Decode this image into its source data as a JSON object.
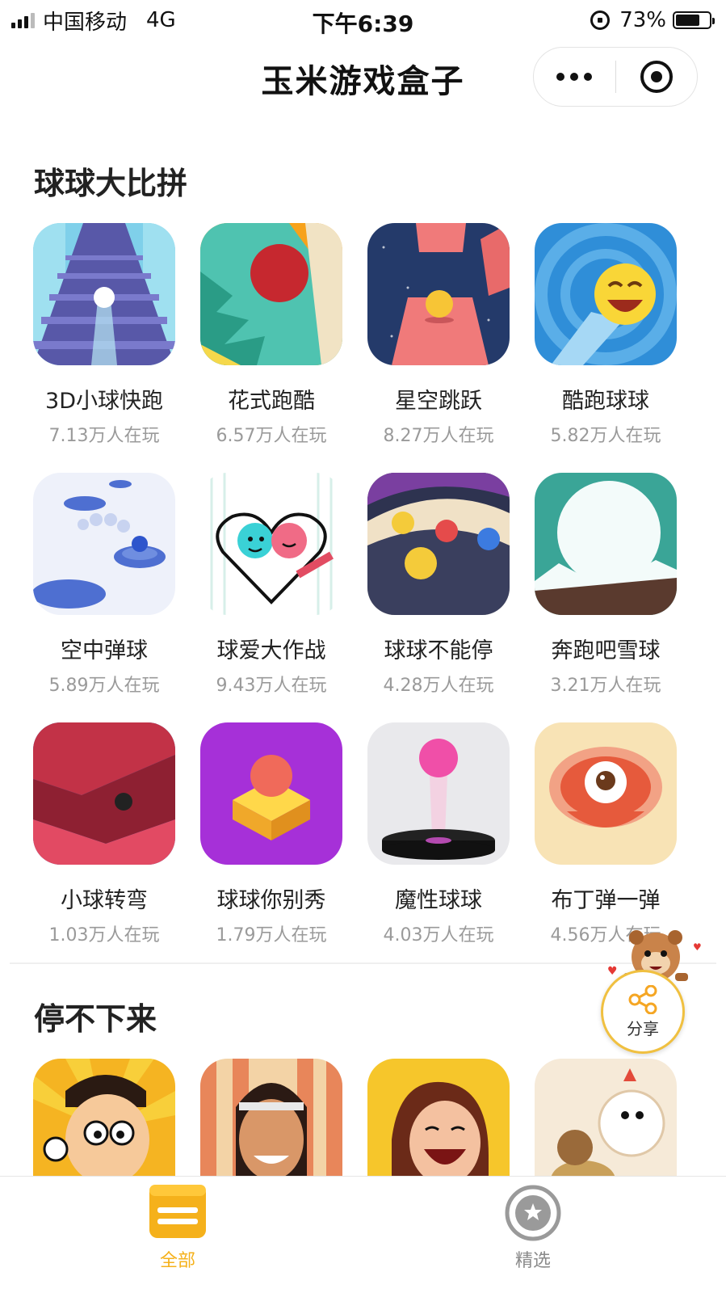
{
  "status_bar": {
    "carrier": "中国移动",
    "network": "4G",
    "time": "下午6:39",
    "battery": "73%",
    "battery_level": 0.73
  },
  "nav": {
    "title": "玉米游戏盒子",
    "more_icon": "more-dots-icon",
    "close_icon": "target-close-icon"
  },
  "sections": [
    {
      "title": "球球大比拼",
      "games": [
        {
          "name": "3D小球快跑",
          "players": "7.13万人在玩"
        },
        {
          "name": "花式跑酷",
          "players": "6.57万人在玩"
        },
        {
          "name": "星空跳跃",
          "players": "8.27万人在玩"
        },
        {
          "name": "酷跑球球",
          "players": "5.82万人在玩"
        },
        {
          "name": "空中弹球",
          "players": "5.89万人在玩"
        },
        {
          "name": "球爱大作战",
          "players": "9.43万人在玩"
        },
        {
          "name": "球球不能停",
          "players": "4.28万人在玩"
        },
        {
          "name": "奔跑吧雪球",
          "players": "3.21万人在玩"
        },
        {
          "name": "小球转弯",
          "players": "1.03万人在玩"
        },
        {
          "name": "球球你别秀",
          "players": "1.79万人在玩"
        },
        {
          "name": "魔性球球",
          "players": "4.03万人在玩"
        },
        {
          "name": "布丁弹一弹",
          "players": "4.56万人在玩"
        }
      ]
    },
    {
      "title": "停不下来"
    }
  ],
  "share": {
    "label": "分享",
    "icon": "share-icon"
  },
  "tabbar": {
    "tabs": [
      {
        "label": "全部",
        "icon": "box-icon",
        "active": true
      },
      {
        "label": "精选",
        "icon": "star-badge-icon",
        "active": false
      }
    ]
  },
  "colors": {
    "accent": "#f5b11b",
    "inactive_tab": "#8a8a8a",
    "text_primary": "#222222",
    "text_secondary": "#9a9a9a"
  }
}
